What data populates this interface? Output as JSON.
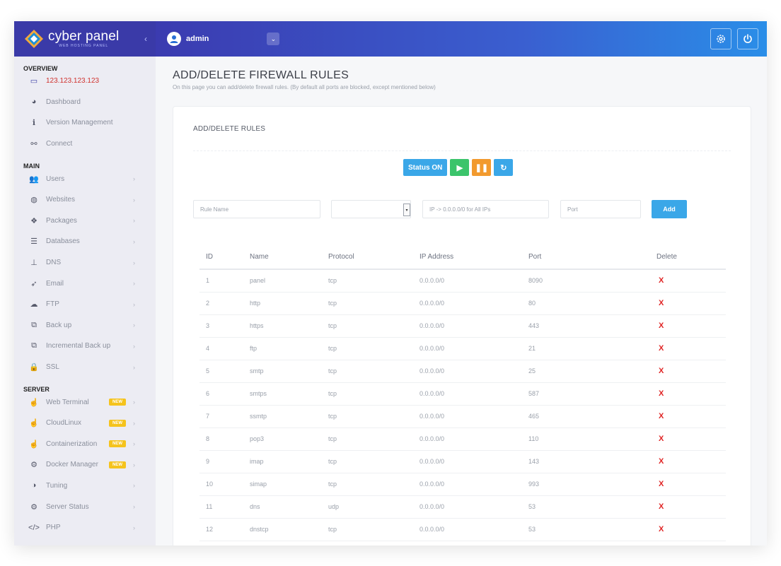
{
  "brand": {
    "name": "cyber panel",
    "tagline": "WEB HOSTING PANEL",
    "collapse_icon": "chevron-left-icon"
  },
  "topbar": {
    "username": "admin",
    "settings_icon": "gear-icon",
    "power_icon": "power-icon"
  },
  "sidebar": {
    "sections": [
      {
        "title": "OVERVIEW",
        "items": [
          {
            "label": "123.123.123.123",
            "icon": "monitor-icon",
            "chevron": false
          },
          {
            "label": "Dashboard",
            "icon": "dashboard-icon",
            "chevron": false
          },
          {
            "label": "Version Management",
            "icon": "info-icon",
            "chevron": false
          },
          {
            "label": "Connect",
            "icon": "link-icon",
            "chevron": false
          }
        ]
      },
      {
        "title": "MAIN",
        "items": [
          {
            "label": "Users",
            "icon": "users-icon",
            "chevron": true
          },
          {
            "label": "Websites",
            "icon": "globe-icon",
            "chevron": true
          },
          {
            "label": "Packages",
            "icon": "packages-icon",
            "chevron": true
          },
          {
            "label": "Databases",
            "icon": "database-icon",
            "chevron": true
          },
          {
            "label": "DNS",
            "icon": "sitemap-icon",
            "chevron": true
          },
          {
            "label": "Email",
            "icon": "paper-plane-icon",
            "chevron": true
          },
          {
            "label": "FTP",
            "icon": "cloud-upload-icon",
            "chevron": true
          },
          {
            "label": "Back up",
            "icon": "copy-icon",
            "chevron": true
          },
          {
            "label": "Incremental Back up",
            "icon": "copy-icon",
            "chevron": true
          },
          {
            "label": "SSL",
            "icon": "lock-icon",
            "chevron": true
          }
        ]
      },
      {
        "title": "SERVER",
        "items": [
          {
            "label": "Web Terminal",
            "icon": "pointer-icon",
            "chevron": true,
            "badge": "NEW"
          },
          {
            "label": "CloudLinux",
            "icon": "pointer-icon",
            "chevron": true,
            "badge": "NEW"
          },
          {
            "label": "Containerization",
            "icon": "pointer-icon",
            "chevron": true,
            "badge": "NEW"
          },
          {
            "label": "Docker Manager",
            "icon": "cogs-icon",
            "chevron": true,
            "badge": "NEW"
          },
          {
            "label": "Tuning",
            "icon": "contrast-icon",
            "chevron": true
          },
          {
            "label": "Server Status",
            "icon": "gear-icon",
            "chevron": true
          },
          {
            "label": "PHP",
            "icon": "code-icon",
            "chevron": true
          }
        ]
      }
    ]
  },
  "page": {
    "title": "ADD/DELETE FIREWALL RULES",
    "description": "On this page you can add/delete firewall rules. (By default all ports are blocked, except mentioned below)"
  },
  "card": {
    "title": "ADD/DELETE RULES"
  },
  "controls": {
    "status_label": "Status ON",
    "start_icon": "play-icon",
    "pause_icon": "pause-icon",
    "reload_icon": "refresh-icon"
  },
  "form": {
    "rule_name_placeholder": "Rule Name",
    "protocol_value": "",
    "ip_placeholder": "IP -> 0.0.0.0/0 for All IPs",
    "port_placeholder": "Port",
    "add_label": "Add"
  },
  "table": {
    "columns": [
      "ID",
      "Name",
      "Protocol",
      "IP Address",
      "Port",
      "Delete"
    ],
    "rows": [
      {
        "id": "1",
        "name": "panel",
        "protocol": "tcp",
        "ip": "0.0.0.0/0",
        "port": "8090",
        "delete": "X"
      },
      {
        "id": "2",
        "name": "http",
        "protocol": "tcp",
        "ip": "0.0.0.0/0",
        "port": "80",
        "delete": "X"
      },
      {
        "id": "3",
        "name": "https",
        "protocol": "tcp",
        "ip": "0.0.0.0/0",
        "port": "443",
        "delete": "X"
      },
      {
        "id": "4",
        "name": "ftp",
        "protocol": "tcp",
        "ip": "0.0.0.0/0",
        "port": "21",
        "delete": "X"
      },
      {
        "id": "5",
        "name": "smtp",
        "protocol": "tcp",
        "ip": "0.0.0.0/0",
        "port": "25",
        "delete": "X"
      },
      {
        "id": "6",
        "name": "smtps",
        "protocol": "tcp",
        "ip": "0.0.0.0/0",
        "port": "587",
        "delete": "X"
      },
      {
        "id": "7",
        "name": "ssmtp",
        "protocol": "tcp",
        "ip": "0.0.0.0/0",
        "port": "465",
        "delete": "X"
      },
      {
        "id": "8",
        "name": "pop3",
        "protocol": "tcp",
        "ip": "0.0.0.0/0",
        "port": "110",
        "delete": "X"
      },
      {
        "id": "9",
        "name": "imap",
        "protocol": "tcp",
        "ip": "0.0.0.0/0",
        "port": "143",
        "delete": "X"
      },
      {
        "id": "10",
        "name": "simap",
        "protocol": "tcp",
        "ip": "0.0.0.0/0",
        "port": "993",
        "delete": "X"
      },
      {
        "id": "11",
        "name": "dns",
        "protocol": "udp",
        "ip": "0.0.0.0/0",
        "port": "53",
        "delete": "X"
      },
      {
        "id": "12",
        "name": "dnstcp",
        "protocol": "tcp",
        "ip": "0.0.0.0/0",
        "port": "53",
        "delete": "X"
      }
    ]
  },
  "colors": {
    "sidebar_header": "#3a3aa8",
    "accent_blue": "#3aa7e8",
    "start_green": "#3bc46b",
    "pause_orange": "#f29a2e",
    "delete_red": "#e02424",
    "badge_yellow": "#f5c31d"
  }
}
